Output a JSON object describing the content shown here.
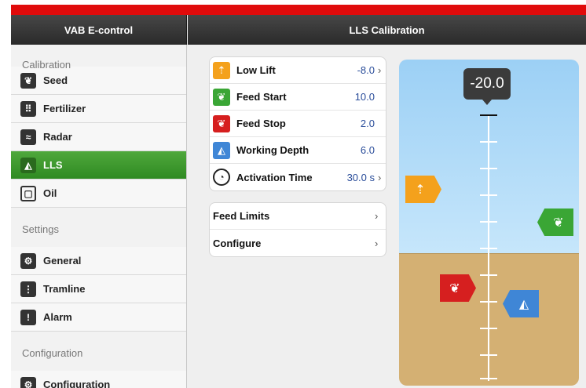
{
  "header": {
    "left_title": "VAB E-control",
    "right_title": "LLS Calibration"
  },
  "sidebar": {
    "sections": [
      {
        "label": "Calibration",
        "items": [
          {
            "label": "Seed",
            "icon": "seed-icon",
            "glyph": "❦"
          },
          {
            "label": "Fertilizer",
            "icon": "fertilizer-icon",
            "glyph": "⠿"
          },
          {
            "label": "Radar",
            "icon": "radar-icon",
            "glyph": "≈"
          },
          {
            "label": "LLS",
            "icon": "lls-icon",
            "glyph": "◭",
            "active": true
          },
          {
            "label": "Oil",
            "icon": "oil-icon",
            "glyph": "▢"
          }
        ]
      },
      {
        "label": "Settings",
        "items": [
          {
            "label": "General",
            "icon": "gears-icon",
            "glyph": "⚙"
          },
          {
            "label": "Tramline",
            "icon": "tramline-icon",
            "glyph": "⋮"
          },
          {
            "label": "Alarm",
            "icon": "alarm-icon",
            "glyph": "!"
          }
        ]
      },
      {
        "label": "Configuration",
        "items": [
          {
            "label": "Configuration",
            "icon": "gears-icon",
            "glyph": "⚙"
          }
        ]
      }
    ]
  },
  "settings": [
    {
      "label": "Low Lift",
      "value": "-8.0",
      "icon": "low-lift-icon",
      "color": "#f4a11c",
      "glyph": "⇡",
      "chevron": true
    },
    {
      "label": "Feed Start",
      "value": "10.0",
      "icon": "feed-start-icon",
      "color": "#3aa635",
      "glyph": "❦",
      "chevron": false
    },
    {
      "label": "Feed Stop",
      "value": "2.0",
      "icon": "feed-stop-icon",
      "color": "#d61f1f",
      "glyph": "❦",
      "chevron": false
    },
    {
      "label": "Working Depth",
      "value": "6.0",
      "icon": "working-depth-icon",
      "color": "#3f86d6",
      "glyph": "◭",
      "chevron": false
    },
    {
      "label": "Activation Time",
      "value": "30.0 s",
      "icon": "stopwatch-icon",
      "color": "#ffffff",
      "glyph": "◔",
      "chevron": true
    }
  ],
  "links": [
    {
      "label": "Feed Limits"
    },
    {
      "label": "Configure"
    }
  ],
  "gauge": {
    "readout": "-20.0",
    "colors": {
      "sky": "#a8d6f7",
      "soil": "#d4b073",
      "low_lift": "#f4a11c",
      "feed_start": "#3aa635",
      "feed_stop": "#d61f1f",
      "working_depth": "#3f86d6"
    }
  }
}
